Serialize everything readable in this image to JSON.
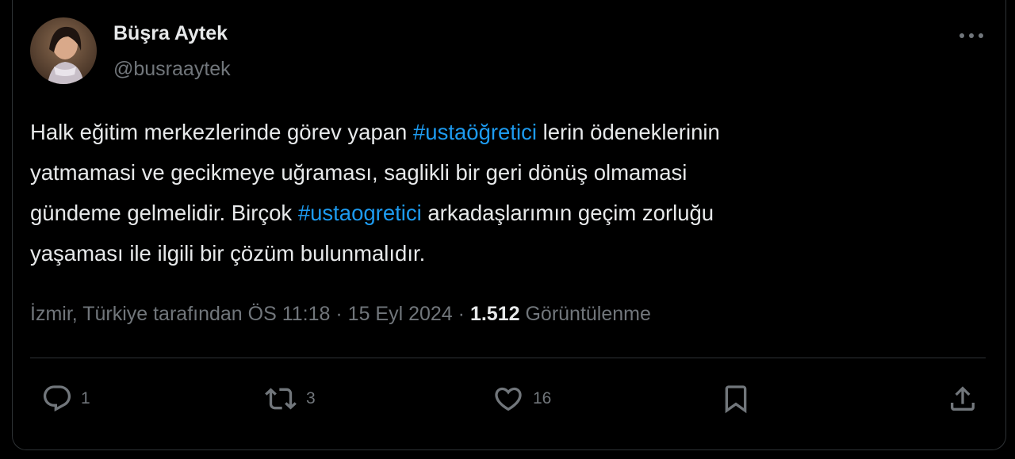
{
  "tweet": {
    "author": {
      "name": "Büşra Aytek",
      "handle": "@busraaytek",
      "avatar_icon": "profile-photo"
    },
    "text_parts": {
      "p1": "Halk eğitim merkezlerinde görev yapan ",
      "hashtag1": "#ustaöğretici",
      "p2": " lerin ödeneklerinin\nyatmamasi ve gecikmeye uğraması, saglikli bir geri dönüş olmamasi\ngündeme gelmelidir. Birçok ",
      "hashtag2": "#ustaogretici",
      "p3": " arkadaşlarımın geçim zorluğu\nyaşaması ile ilgili bir çözüm bulunmalıdır."
    },
    "meta": {
      "location": "İzmir, Türkiye tarafından",
      "time": "ÖS 11:18",
      "separator": "·",
      "date": "15 Eyl 2024",
      "views_count": "1.512",
      "views_label": "Görüntülenme"
    },
    "actions": {
      "reply": {
        "icon": "reply-icon",
        "count": "1"
      },
      "retweet": {
        "icon": "retweet-icon",
        "count": "3"
      },
      "like": {
        "icon": "heart-icon",
        "count": "16"
      },
      "bookmark": {
        "icon": "bookmark-icon"
      },
      "share": {
        "icon": "share-icon"
      }
    },
    "more_icon": "more-icon"
  },
  "colors": {
    "background": "#000000",
    "text_primary": "#e7e9ea",
    "text_secondary": "#71767b",
    "link": "#1d9bf0",
    "border": "#2f3336"
  }
}
